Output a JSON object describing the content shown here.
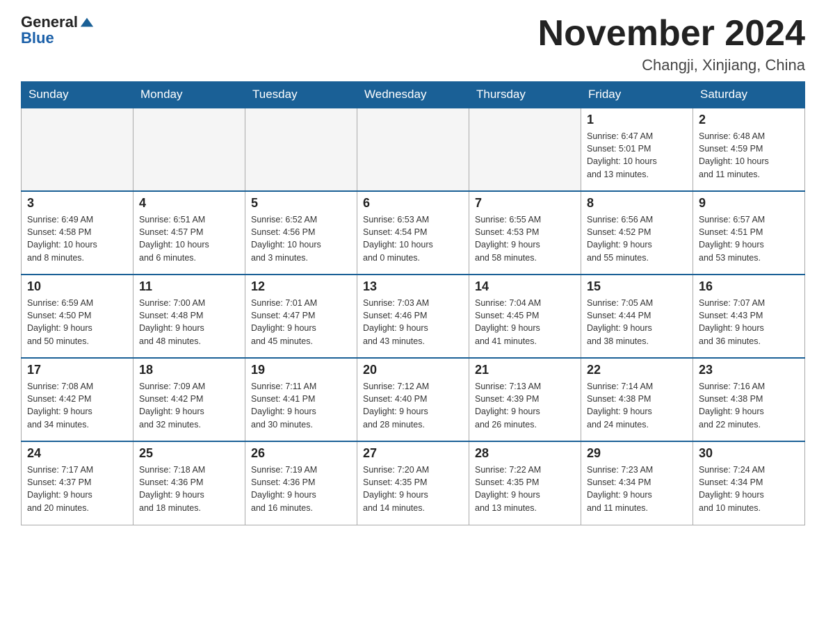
{
  "logo": {
    "general": "General",
    "blue": "Blue"
  },
  "header": {
    "title": "November 2024",
    "subtitle": "Changji, Xinjiang, China"
  },
  "weekdays": [
    "Sunday",
    "Monday",
    "Tuesday",
    "Wednesday",
    "Thursday",
    "Friday",
    "Saturday"
  ],
  "weeks": [
    [
      {
        "day": "",
        "info": ""
      },
      {
        "day": "",
        "info": ""
      },
      {
        "day": "",
        "info": ""
      },
      {
        "day": "",
        "info": ""
      },
      {
        "day": "",
        "info": ""
      },
      {
        "day": "1",
        "info": "Sunrise: 6:47 AM\nSunset: 5:01 PM\nDaylight: 10 hours\nand 13 minutes."
      },
      {
        "day": "2",
        "info": "Sunrise: 6:48 AM\nSunset: 4:59 PM\nDaylight: 10 hours\nand 11 minutes."
      }
    ],
    [
      {
        "day": "3",
        "info": "Sunrise: 6:49 AM\nSunset: 4:58 PM\nDaylight: 10 hours\nand 8 minutes."
      },
      {
        "day": "4",
        "info": "Sunrise: 6:51 AM\nSunset: 4:57 PM\nDaylight: 10 hours\nand 6 minutes."
      },
      {
        "day": "5",
        "info": "Sunrise: 6:52 AM\nSunset: 4:56 PM\nDaylight: 10 hours\nand 3 minutes."
      },
      {
        "day": "6",
        "info": "Sunrise: 6:53 AM\nSunset: 4:54 PM\nDaylight: 10 hours\nand 0 minutes."
      },
      {
        "day": "7",
        "info": "Sunrise: 6:55 AM\nSunset: 4:53 PM\nDaylight: 9 hours\nand 58 minutes."
      },
      {
        "day": "8",
        "info": "Sunrise: 6:56 AM\nSunset: 4:52 PM\nDaylight: 9 hours\nand 55 minutes."
      },
      {
        "day": "9",
        "info": "Sunrise: 6:57 AM\nSunset: 4:51 PM\nDaylight: 9 hours\nand 53 minutes."
      }
    ],
    [
      {
        "day": "10",
        "info": "Sunrise: 6:59 AM\nSunset: 4:50 PM\nDaylight: 9 hours\nand 50 minutes."
      },
      {
        "day": "11",
        "info": "Sunrise: 7:00 AM\nSunset: 4:48 PM\nDaylight: 9 hours\nand 48 minutes."
      },
      {
        "day": "12",
        "info": "Sunrise: 7:01 AM\nSunset: 4:47 PM\nDaylight: 9 hours\nand 45 minutes."
      },
      {
        "day": "13",
        "info": "Sunrise: 7:03 AM\nSunset: 4:46 PM\nDaylight: 9 hours\nand 43 minutes."
      },
      {
        "day": "14",
        "info": "Sunrise: 7:04 AM\nSunset: 4:45 PM\nDaylight: 9 hours\nand 41 minutes."
      },
      {
        "day": "15",
        "info": "Sunrise: 7:05 AM\nSunset: 4:44 PM\nDaylight: 9 hours\nand 38 minutes."
      },
      {
        "day": "16",
        "info": "Sunrise: 7:07 AM\nSunset: 4:43 PM\nDaylight: 9 hours\nand 36 minutes."
      }
    ],
    [
      {
        "day": "17",
        "info": "Sunrise: 7:08 AM\nSunset: 4:42 PM\nDaylight: 9 hours\nand 34 minutes."
      },
      {
        "day": "18",
        "info": "Sunrise: 7:09 AM\nSunset: 4:42 PM\nDaylight: 9 hours\nand 32 minutes."
      },
      {
        "day": "19",
        "info": "Sunrise: 7:11 AM\nSunset: 4:41 PM\nDaylight: 9 hours\nand 30 minutes."
      },
      {
        "day": "20",
        "info": "Sunrise: 7:12 AM\nSunset: 4:40 PM\nDaylight: 9 hours\nand 28 minutes."
      },
      {
        "day": "21",
        "info": "Sunrise: 7:13 AM\nSunset: 4:39 PM\nDaylight: 9 hours\nand 26 minutes."
      },
      {
        "day": "22",
        "info": "Sunrise: 7:14 AM\nSunset: 4:38 PM\nDaylight: 9 hours\nand 24 minutes."
      },
      {
        "day": "23",
        "info": "Sunrise: 7:16 AM\nSunset: 4:38 PM\nDaylight: 9 hours\nand 22 minutes."
      }
    ],
    [
      {
        "day": "24",
        "info": "Sunrise: 7:17 AM\nSunset: 4:37 PM\nDaylight: 9 hours\nand 20 minutes."
      },
      {
        "day": "25",
        "info": "Sunrise: 7:18 AM\nSunset: 4:36 PM\nDaylight: 9 hours\nand 18 minutes."
      },
      {
        "day": "26",
        "info": "Sunrise: 7:19 AM\nSunset: 4:36 PM\nDaylight: 9 hours\nand 16 minutes."
      },
      {
        "day": "27",
        "info": "Sunrise: 7:20 AM\nSunset: 4:35 PM\nDaylight: 9 hours\nand 14 minutes."
      },
      {
        "day": "28",
        "info": "Sunrise: 7:22 AM\nSunset: 4:35 PM\nDaylight: 9 hours\nand 13 minutes."
      },
      {
        "day": "29",
        "info": "Sunrise: 7:23 AM\nSunset: 4:34 PM\nDaylight: 9 hours\nand 11 minutes."
      },
      {
        "day": "30",
        "info": "Sunrise: 7:24 AM\nSunset: 4:34 PM\nDaylight: 9 hours\nand 10 minutes."
      }
    ]
  ]
}
